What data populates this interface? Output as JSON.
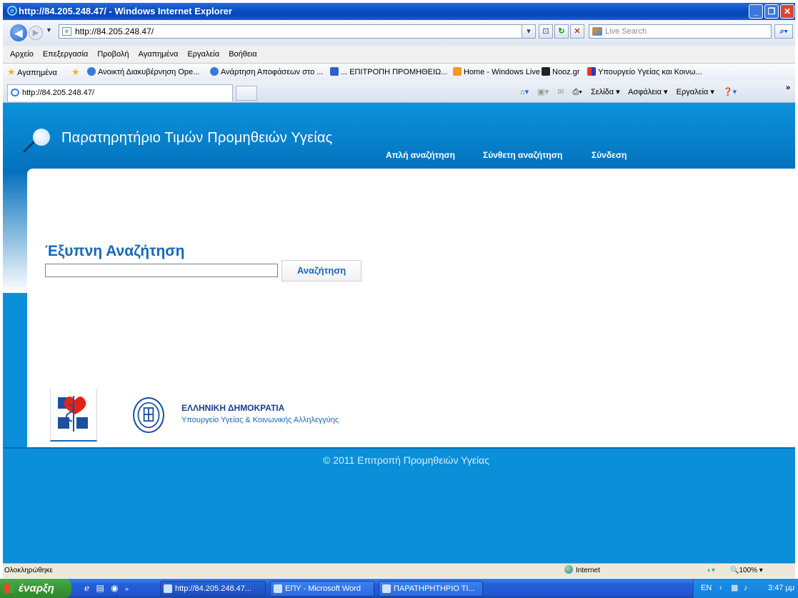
{
  "window": {
    "title": "http://84.205.248.47/ - Windows Internet Explorer",
    "min": "_",
    "max": "❐",
    "close": "✕"
  },
  "address_bar": {
    "url": "http://84.205.248.47/",
    "search_placeholder": "Live Search"
  },
  "menu": [
    "Αρχείο",
    "Επεξεργασία",
    "Προβολή",
    "Αγαπημένα",
    "Εργαλεία",
    "Βοήθεια"
  ],
  "favorites": {
    "label": "Αγαπημένα",
    "items": [
      "Ανοικτή Διακυβέρνηση Ope...",
      "Ανάρτηση Αποφάσεων στο ...",
      "... ΕΠΙΤΡΟΠΗ ΠΡΟΜΗΘΕΙΩ...",
      "Home - Windows Live",
      "Nooz.gr",
      "Υπουργείο Υγείας και Κοινω..."
    ]
  },
  "tab": {
    "label": "http://84.205.248.47/"
  },
  "command_bar": [
    "Σελίδα ▾",
    "Ασφάλεια ▾",
    "Εργαλεία ▾"
  ],
  "site": {
    "title": "Παρατηρητήριο Τιμών Προμηθειών Υγείας",
    "nav": [
      "Απλή αναζήτηση",
      "Σύνθετη αναζήτηση",
      "Σύνδεση"
    ],
    "search_heading": "Έξυπνη Αναζήτηση",
    "search_button": "Αναζήτηση",
    "search_value": "",
    "org_title": "ΕΛΛΗΝΙΚΗ ΔΗΜΟΚΡΑΤΙΑ",
    "org_subtitle": "Υπουργείο Υγείας & Κοινωνικής Αλληλεγγύης",
    "copyright": "© 2011 Επιτροπή Προμηθειών Υγείας"
  },
  "status": {
    "text": "Ολοκληρώθηκε",
    "zone": "Internet",
    "zoom": "100%"
  },
  "taskbar": {
    "start": "έναρξη",
    "tasks": [
      "http://84.205.248.47...",
      "ΕΠΥ - Microsoft Word",
      "ΠΑΡΑΤΗΡΗΤΗΡΙΟ ΤΙ..."
    ],
    "lang": "EN",
    "time": "3:47 μμ"
  },
  "colors": {
    "brand_blue": "#0a8fd8",
    "heading_blue": "#1667b9"
  }
}
